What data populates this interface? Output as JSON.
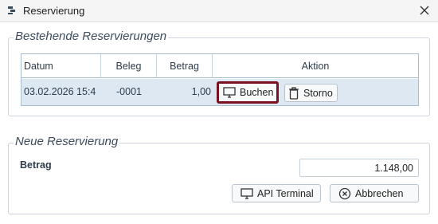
{
  "window": {
    "title": "Reservierung"
  },
  "existing": {
    "legend": "Bestehende Reservierungen",
    "columns": [
      "Datum",
      "Beleg",
      "Betrag",
      "Aktion"
    ],
    "rows": [
      {
        "datum": "03.02.2026 15:4",
        "beleg": "-0001",
        "betrag": "1,00"
      }
    ],
    "buchen_label": "Buchen",
    "storno_label": "Storno"
  },
  "new": {
    "legend": "Neue Reservierung",
    "betrag_label": "Betrag",
    "betrag_value": "1.148,00",
    "api_terminal_label": "API Terminal",
    "abbrechen_label": "Abbrechen"
  },
  "icons": {
    "app": "app-icon",
    "close": "close-icon",
    "buchen": "monitor-icon",
    "storno": "trash-icon",
    "api_terminal": "monitor-icon",
    "abbrechen": "cancel-circle-icon"
  },
  "colors": {
    "focus_border": "#7a1020",
    "selected_row": "#dde8f3",
    "legend_text": "#3a4a5c"
  }
}
